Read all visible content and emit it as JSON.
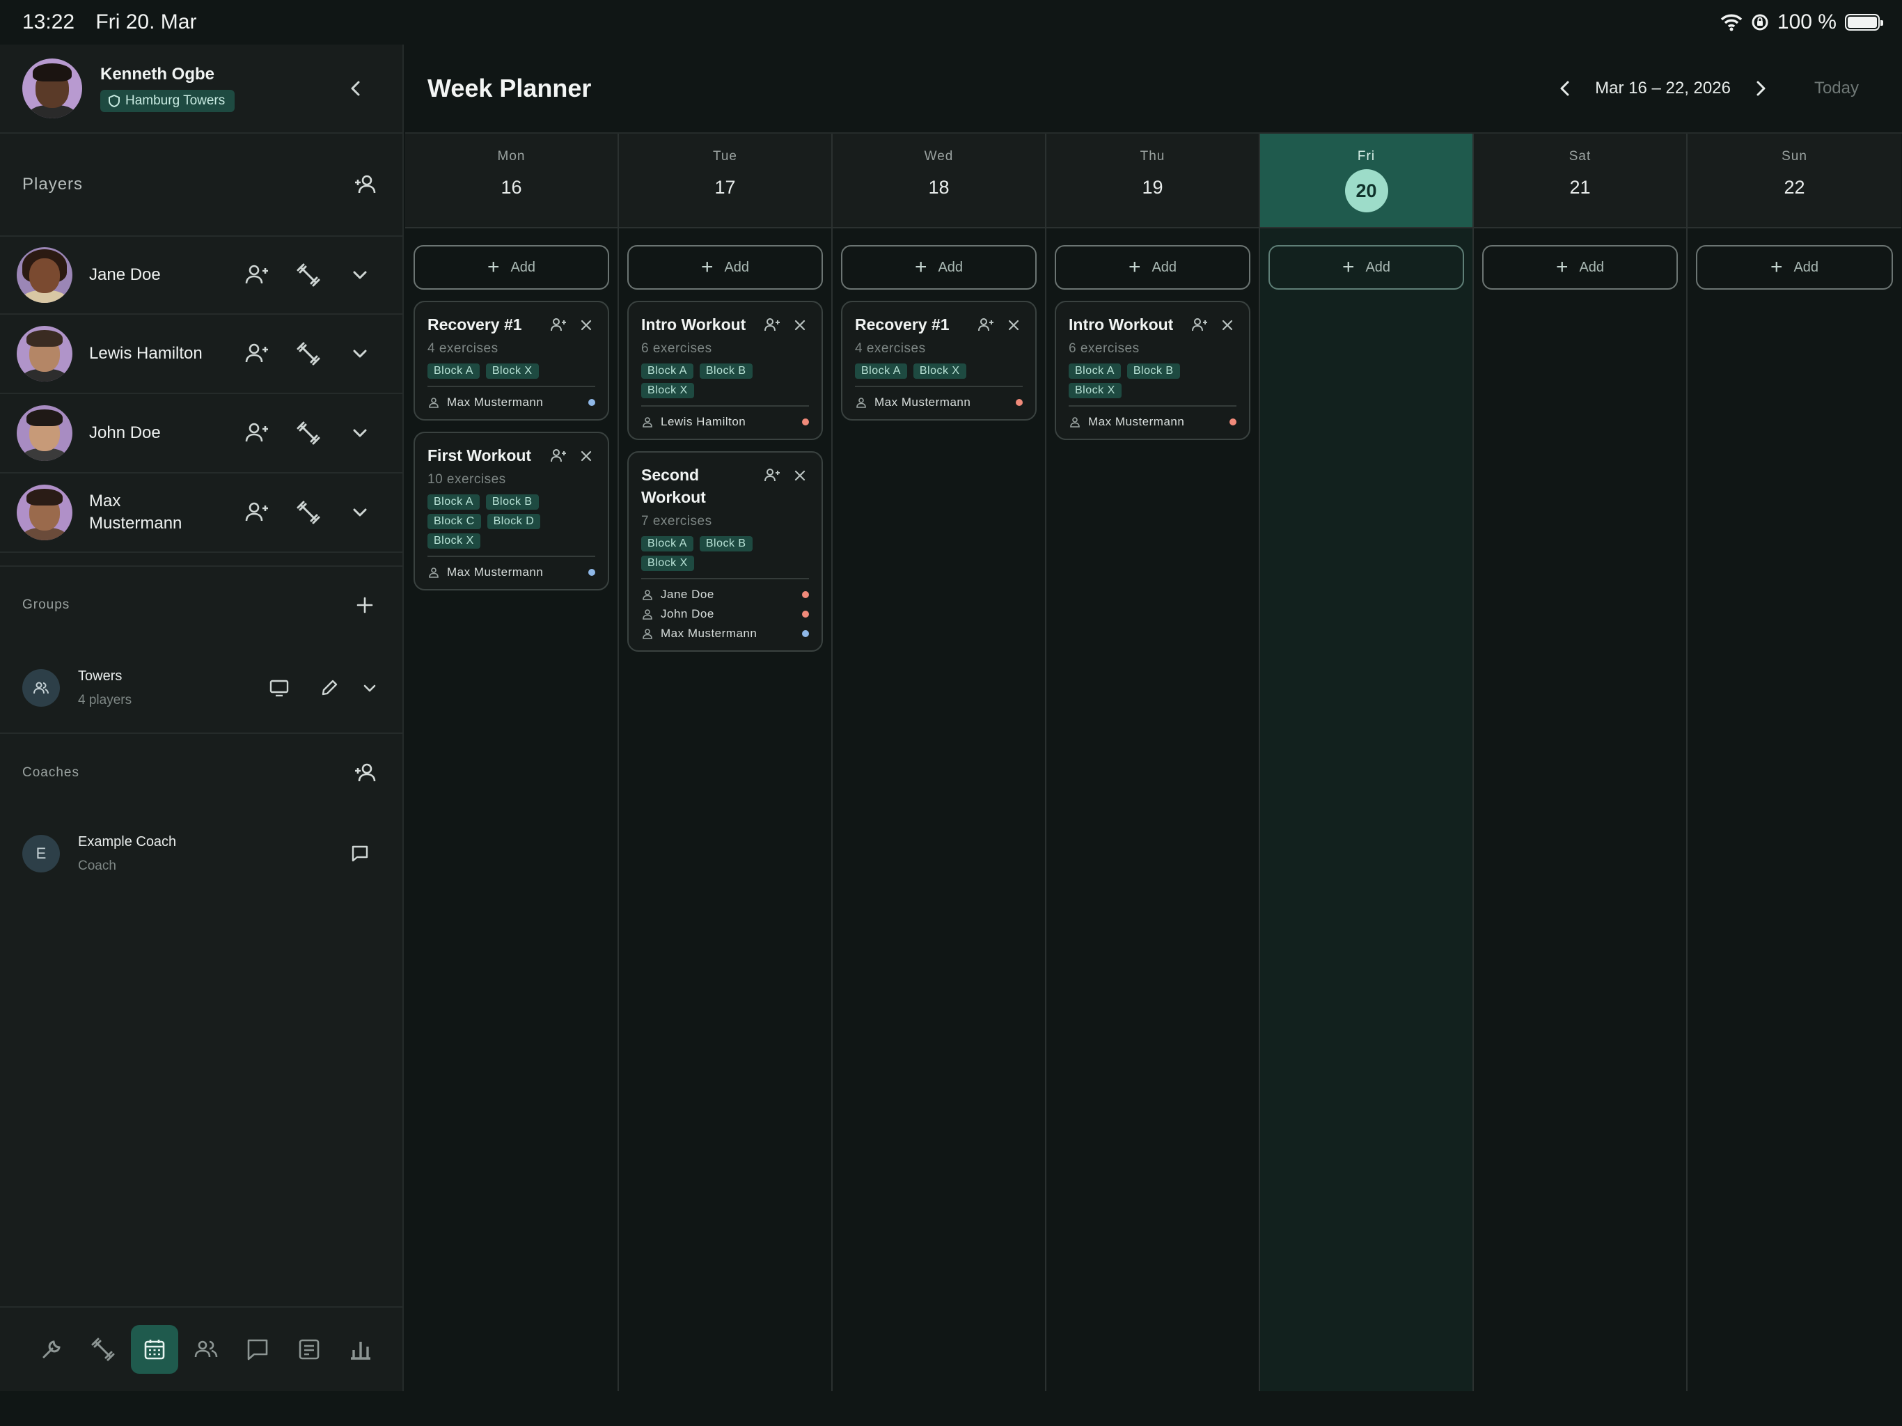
{
  "status_bar": {
    "time": "13:22",
    "date": "Fri 20. Mar",
    "battery": "100 %"
  },
  "colors": {
    "accent": "#1f5a4d",
    "tag_bg": "#1e4a41",
    "dot_blue": "#8fb8e8",
    "dot_red": "#f08a7a"
  },
  "sidebar": {
    "profile": {
      "name": "Kenneth Ogbe",
      "team": "Hamburg Towers"
    },
    "players_title": "Players",
    "players": [
      {
        "name": "Jane Doe"
      },
      {
        "name": "Lewis Hamilton"
      },
      {
        "name": "John Doe"
      },
      {
        "name": "Max Mustermann"
      }
    ],
    "groups_title": "Groups",
    "groups": [
      {
        "name": "Towers",
        "sub": "4 players"
      }
    ],
    "coaches_title": "Coaches",
    "coaches": [
      {
        "initial": "E",
        "name": "Example Coach",
        "role": "Coach"
      }
    ],
    "tabs": [
      "wrench-icon",
      "dumbbell-icon",
      "calendar-icon",
      "people-icon",
      "chat-icon",
      "notes-icon",
      "bar-chart-icon"
    ]
  },
  "main": {
    "title": "Week Planner",
    "range": "Mar 16 – 22, 2026",
    "today_label": "Today",
    "add_label": "Add",
    "days": [
      {
        "dow": "Mon",
        "num": "16"
      },
      {
        "dow": "Tue",
        "num": "17"
      },
      {
        "dow": "Wed",
        "num": "18"
      },
      {
        "dow": "Thu",
        "num": "19"
      },
      {
        "dow": "Fri",
        "num": "20"
      },
      {
        "dow": "Sat",
        "num": "21"
      },
      {
        "dow": "Sun",
        "num": "22"
      }
    ],
    "cards": {
      "mon1": {
        "title": "Recovery #1",
        "sub": "4 exercises",
        "tags": [
          "Block A",
          "Block X"
        ],
        "assignees": [
          "Max Mustermann"
        ]
      },
      "mon2": {
        "title": "First Workout",
        "sub": "10 exercises",
        "tags": [
          "Block A",
          "Block B",
          "Block C",
          "Block D",
          "Block X"
        ],
        "assignees": [
          "Max Mustermann"
        ]
      },
      "tue1": {
        "title": "Intro Workout",
        "sub": "6 exercises",
        "tags": [
          "Block A",
          "Block B",
          "Block X"
        ],
        "assignees": [
          "Lewis Hamilton"
        ]
      },
      "tue2": {
        "title": "Second Workout",
        "sub": "7 exercises",
        "tags": [
          "Block A",
          "Block B",
          "Block X"
        ],
        "assignees": [
          "Jane Doe",
          "John Doe",
          "Max Mustermann"
        ]
      },
      "wed1": {
        "title": "Recovery #1",
        "sub": "4 exercises",
        "tags": [
          "Block A",
          "Block X"
        ],
        "assignees": [
          "Max Mustermann"
        ]
      },
      "thu1": {
        "title": "Intro Workout",
        "sub": "6 exercises",
        "tags": [
          "Block A",
          "Block B",
          "Block X"
        ],
        "assignees": [
          "Max Mustermann"
        ]
      }
    }
  }
}
